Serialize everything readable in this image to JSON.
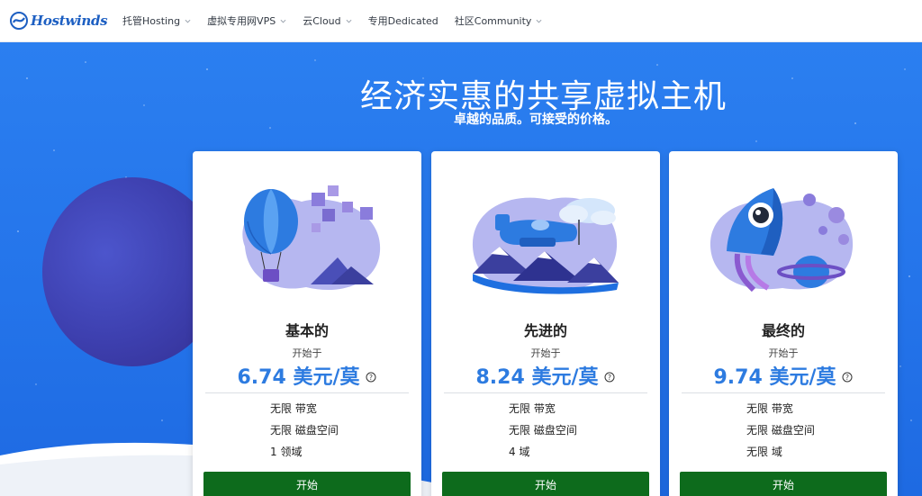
{
  "brand": {
    "name": "Hostwinds"
  },
  "nav": {
    "items": [
      {
        "label": "托管Hosting",
        "dropdown": true
      },
      {
        "label": "虚拟专用网VPS",
        "dropdown": true
      },
      {
        "label": "云Cloud",
        "dropdown": true
      },
      {
        "label": "专用Dedicated",
        "dropdown": false
      },
      {
        "label": "社区Community",
        "dropdown": true
      }
    ]
  },
  "hero": {
    "title": "经济实惠的共享虚拟主机",
    "subtitle": "卓越的品质。可接受的价格。"
  },
  "plans": [
    {
      "name": "基本的",
      "starting_at": "开始于",
      "price": "6.74 美元/莫",
      "illustration": "hot-air-balloon",
      "features": [
        "无限 带宽",
        "无限 磁盘空间",
        "1 领域"
      ],
      "button": "开始"
    },
    {
      "name": "先进的",
      "starting_at": "开始于",
      "price": "8.24 美元/莫",
      "illustration": "airplane",
      "features": [
        "无限 带宽",
        "无限 磁盘空间",
        "4 域"
      ],
      "button": "开始"
    },
    {
      "name": "最终的",
      "starting_at": "开始于",
      "price": "9.74 美元/莫",
      "illustration": "rocket",
      "features": [
        "无限 带宽",
        "无限 磁盘空间",
        "无限 域"
      ],
      "button": "开始"
    }
  ],
  "colors": {
    "brand_blue": "#1d5fc2",
    "hero_blue": "#2474ea",
    "price_blue": "#2d7be0",
    "button_green": "#0d6b1c"
  }
}
